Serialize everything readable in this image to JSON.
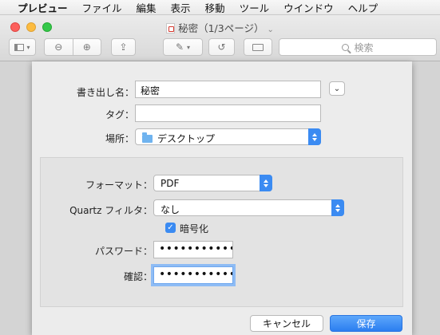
{
  "menubar": {
    "apple": "",
    "items": [
      "プレビュー",
      "ファイル",
      "編集",
      "表示",
      "移動",
      "ツール",
      "ウインドウ",
      "ヘルプ"
    ]
  },
  "window": {
    "title": "秘密（1/3ページ）",
    "search_placeholder": "検索",
    "toolbar_icons": [
      "sidebar-icon",
      "zoom-out-icon",
      "zoom-in-icon",
      "share-icon",
      "markup-pen-icon",
      "rotate-icon",
      "toolbox-icon"
    ]
  },
  "dialog": {
    "export_as_label": "書き出し名：",
    "export_as_value": "秘密",
    "tags_label": "タグ：",
    "tags_value": "",
    "where_label": "場所：",
    "where_value": "デスクトップ",
    "format_label": "フォーマット：",
    "format_value": "PDF",
    "quartz_label": "Quartz フィルタ：",
    "quartz_value": "なし",
    "encrypt_label": "暗号化",
    "encrypt_checked": true,
    "password_label": "パスワード：",
    "password_value": "•••••••••••••",
    "verify_label": "確認：",
    "verify_value": "•••••••••••••",
    "cancel_label": "キャンセル",
    "save_label": "保存"
  },
  "colors": {
    "accent": "#3b8bf2",
    "close": "#fc605c",
    "minimize": "#fdbc40",
    "maximize": "#34c84a"
  }
}
